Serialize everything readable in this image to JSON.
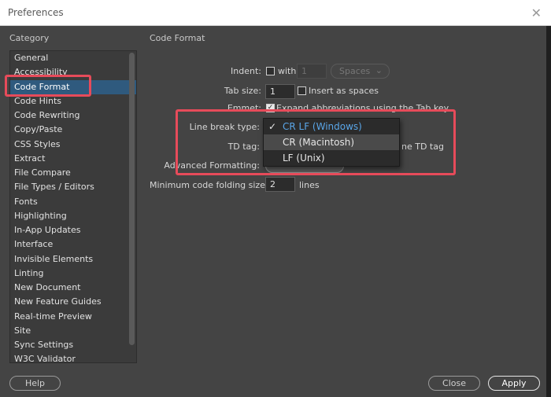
{
  "window": {
    "title": "Preferences",
    "close_glyph": "✕"
  },
  "sidebar": {
    "heading": "Category",
    "items": [
      "General",
      "Accessibility",
      "Code Format",
      "Code Hints",
      "Code Rewriting",
      "Copy/Paste",
      "CSS Styles",
      "Extract",
      "File Compare",
      "File Types / Editors",
      "Fonts",
      "Highlighting",
      "In-App Updates",
      "Interface",
      "Invisible Elements",
      "Linting",
      "New Document",
      "New Feature Guides",
      "Real-time Preview",
      "Site",
      "Sync Settings",
      "W3C Validator"
    ],
    "selected": "Code Format"
  },
  "panel": {
    "heading": "Code Format",
    "indent": {
      "label": "Indent:",
      "checkbox_label": "with",
      "value": "1",
      "unit": "Spaces"
    },
    "tab_size": {
      "label": "Tab size:",
      "value": "1",
      "checkbox_label": "Insert as spaces"
    },
    "emmet": {
      "label": "Emmet:",
      "checkbox_label": "Expand abbreviations using the Tab key"
    },
    "line_break": {
      "label": "Line break type:"
    },
    "td_tag": {
      "label": "TD tag:",
      "checkbox_label_tail": "ne TD tag"
    },
    "advanced": {
      "label": "Advanced Formatting:"
    },
    "folding": {
      "label": "Minimum code folding size:",
      "value": "2",
      "unit": "lines"
    }
  },
  "line_break_dropdown": {
    "options": [
      "CR LF (Windows)",
      "CR (Macintosh)",
      "LF (Unix)"
    ],
    "selected": "CR LF (Windows)",
    "hovered": "CR (Macintosh)",
    "check_glyph": "✓"
  },
  "buttons": {
    "help": "Help",
    "close": "Close",
    "apply": "Apply"
  },
  "colors": {
    "annotation": "#e74b5a",
    "selection": "#2f5a7e",
    "selected_option": "#5aa6e8"
  }
}
